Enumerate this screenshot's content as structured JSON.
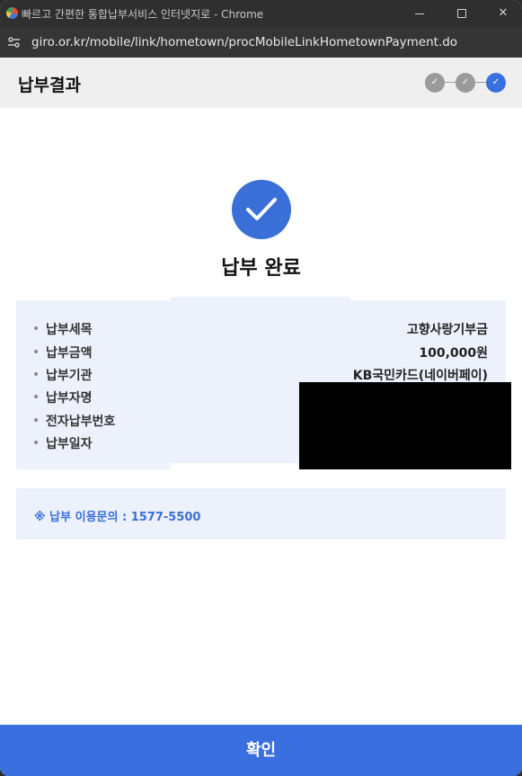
{
  "browser": {
    "window_title": "빠르고 간편한 통합납부서비스 인터넷지로 - Chrome",
    "url": "giro.or.kr/mobile/link/hometown/procMobileLinkHometownPayment.do"
  },
  "header": {
    "title": "납부결과",
    "steps": [
      {
        "state": "done",
        "symbol": "✓"
      },
      {
        "state": "done",
        "symbol": "✓"
      },
      {
        "state": "current",
        "symbol": "✓"
      }
    ]
  },
  "result": {
    "title": "납부 완료"
  },
  "details": [
    {
      "label": "납부세목",
      "value": "고향사랑기부금"
    },
    {
      "label": "납부금액",
      "value": "100,000원"
    },
    {
      "label": "납부기관",
      "value": "KB국민카드(네이버페이)"
    },
    {
      "label": "납부자명",
      "value": ""
    },
    {
      "label": "전자납부번호",
      "value": ""
    },
    {
      "label": "납부일자",
      "value": ""
    }
  ],
  "inquiry": {
    "text": "※ 납부 이용문의 : 1577-5500"
  },
  "footer": {
    "confirm_label": "확인"
  },
  "colors": {
    "accent": "#3a6fe0",
    "step_inactive": "#9a9a9a",
    "info_bg": "#ecf1fb"
  }
}
